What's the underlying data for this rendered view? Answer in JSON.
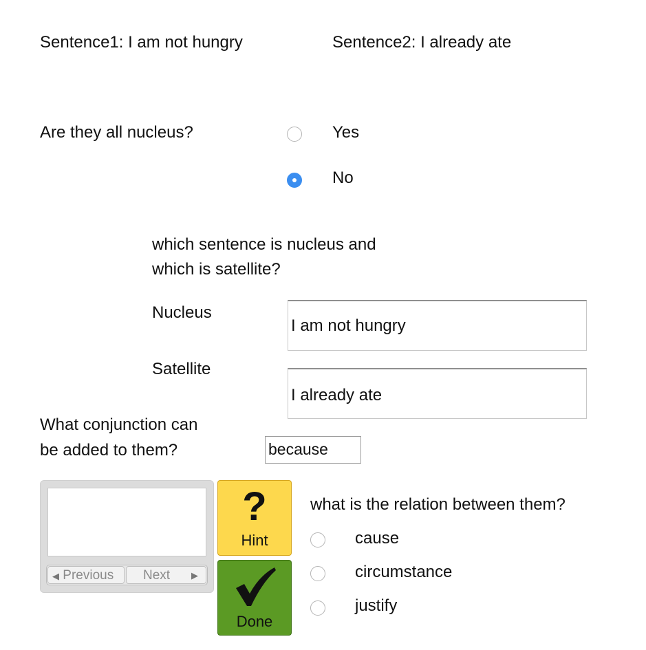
{
  "sentences": {
    "s1": "Sentence1: I am not hungry",
    "s2": "Sentence2: I already ate"
  },
  "nucleus_question": {
    "text": "Are they all nucleus?",
    "options": [
      {
        "label": "Yes",
        "selected": false
      },
      {
        "label": "No",
        "selected": true
      }
    ]
  },
  "which_question": {
    "line1": "which sentence is nucleus and",
    "line2": "which is satellite?"
  },
  "nucleus_field": {
    "label": "Nucleus",
    "value": "I am not hungry"
  },
  "satellite_field": {
    "label": "Satellite",
    "value": "I already ate"
  },
  "conjunction": {
    "line1": "What conjunction can",
    "line2": "be added to them?",
    "value": "because"
  },
  "navigation": {
    "previous": "Previous",
    "next": "Next"
  },
  "hint_button": {
    "label": "Hint",
    "icon": "question-mark-icon"
  },
  "done_button": {
    "label": "Done",
    "icon": "checkmark-icon"
  },
  "relation": {
    "question": "what is the relation between them?",
    "options": [
      {
        "label": "cause",
        "selected": false
      },
      {
        "label": "circumstance",
        "selected": false
      },
      {
        "label": "justify",
        "selected": false
      }
    ]
  },
  "colors": {
    "radio_selected": "#3b8ef0",
    "hint_bg": "#fdd84d",
    "done_bg": "#5b9a24"
  }
}
